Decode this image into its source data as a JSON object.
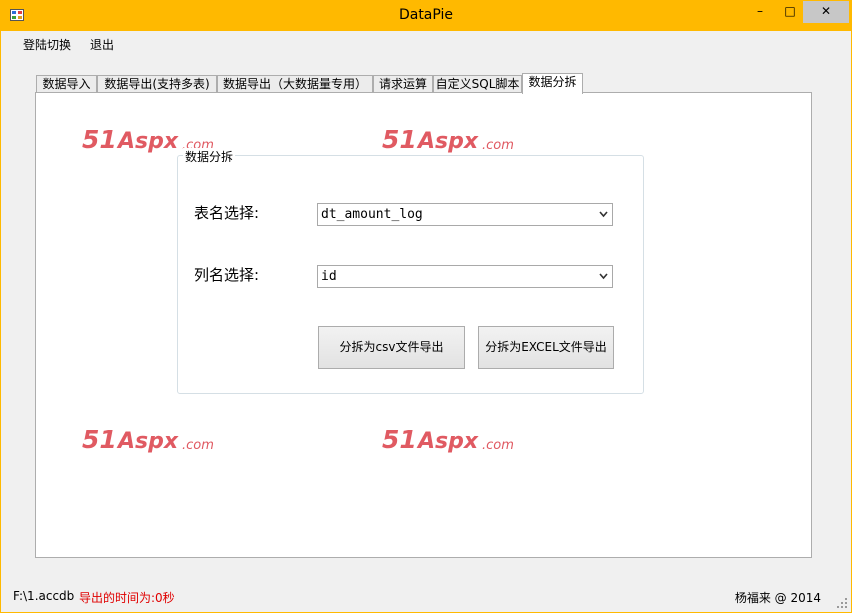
{
  "window": {
    "title": "DataPie",
    "min_glyph": "–",
    "max_glyph": "□",
    "close_glyph": "✕"
  },
  "menu": {
    "items": [
      {
        "label": "登陆切换"
      },
      {
        "label": "退出"
      }
    ]
  },
  "tabs": [
    {
      "label": "数据导入"
    },
    {
      "label": "数据导出(支持多表)"
    },
    {
      "label": "数据导出（大数据量专用）"
    },
    {
      "label": "请求运算"
    },
    {
      "label": "自定义SQL脚本"
    },
    {
      "label": "数据分拆"
    }
  ],
  "watermark": {
    "text": "51Aspx.com"
  },
  "split": {
    "group_title": "数据分拆",
    "table_label": "表名选择:",
    "table_value": "dt_amount_log",
    "column_label": "列名选择:",
    "column_value": "id",
    "csv_button": "分拆为csv文件导出",
    "excel_button": "分拆为EXCEL文件导出"
  },
  "status": {
    "path": "F:\\1.accdb",
    "time_text": "导出的时间为:0秒",
    "copyright": "杨福来 @ 2014"
  },
  "colors": {
    "titlebar": "#ffb900",
    "close_button": "#c7c7c7",
    "status_alert": "#e00000",
    "watermark": "#e05a62"
  }
}
